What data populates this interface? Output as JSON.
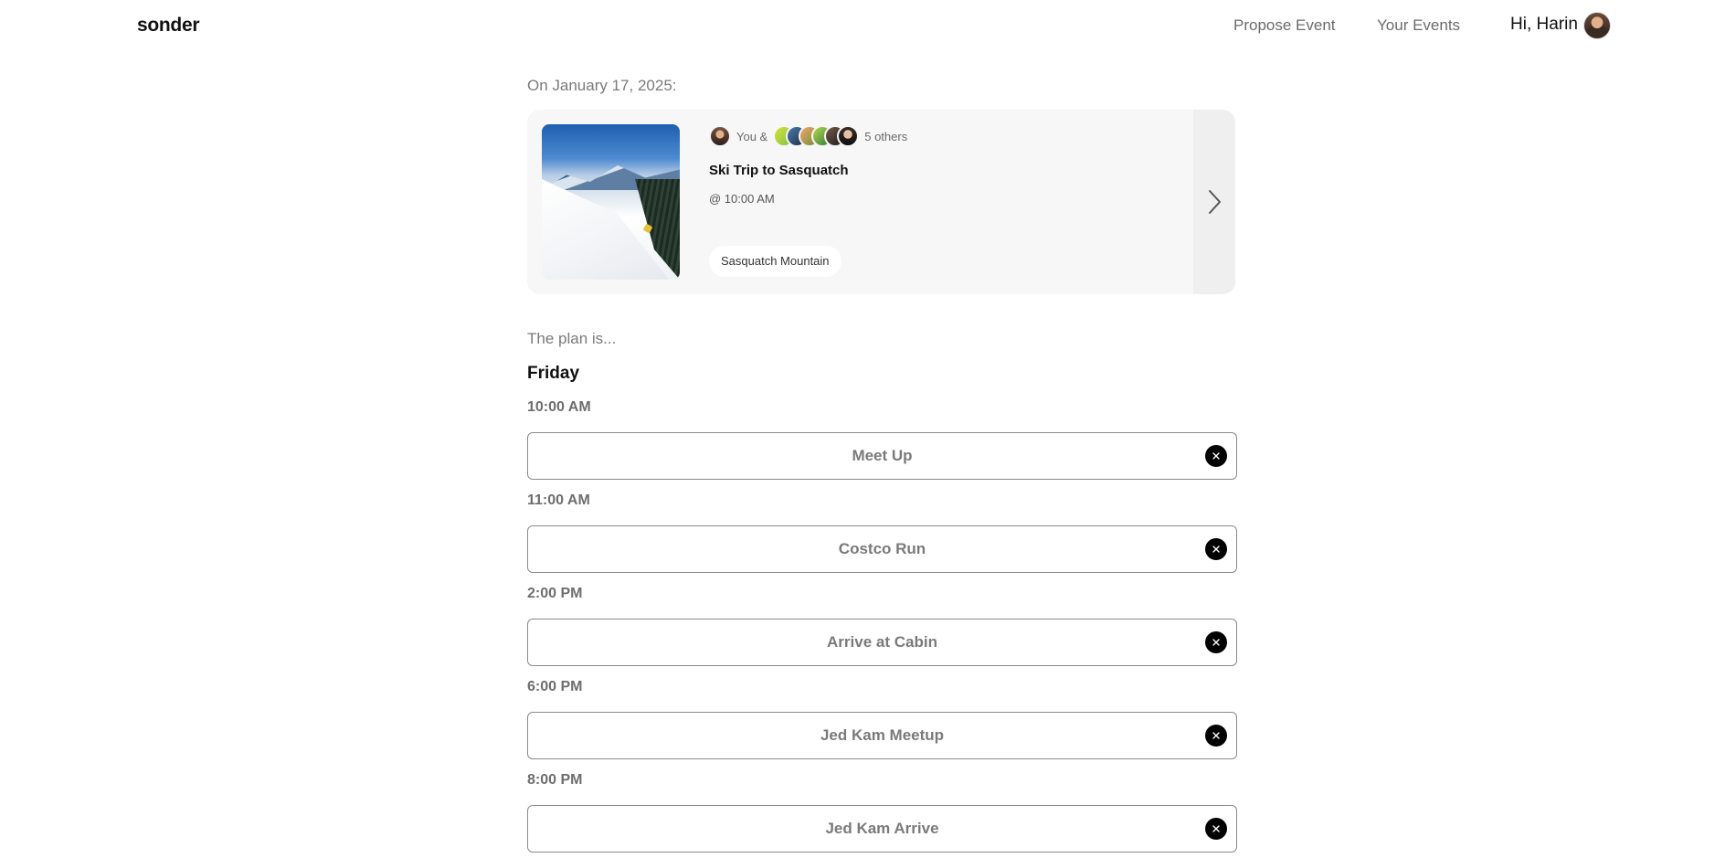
{
  "header": {
    "logo": "sonder",
    "nav": {
      "propose_event": "Propose Event",
      "your_events": "Your Events"
    },
    "greeting": "Hi, Harin"
  },
  "event": {
    "date_label": "On January 17, 2025:",
    "you_label": "You &",
    "others_label": "5 others",
    "title": "Ski Trip to Sasquatch",
    "time": "@ 10:00 AM",
    "location": "Sasquatch Mountain"
  },
  "plan": {
    "intro": "The plan is...",
    "day": "Friday",
    "items": [
      {
        "time": "10:00 AM",
        "label": "Meet Up"
      },
      {
        "time": "11:00 AM",
        "label": "Costco Run"
      },
      {
        "time": "2:00 PM",
        "label": "Arrive at Cabin"
      },
      {
        "time": "6:00 PM",
        "label": "Jed Kam Meetup"
      },
      {
        "time": "8:00 PM",
        "label": "Jed Kam Arrive"
      }
    ]
  },
  "icons": {
    "next": "chevron-right-icon",
    "remove": "close-icon"
  },
  "colors": {
    "card_background": "#f7f7f7",
    "slot_border": "#8a8a8a",
    "muted_text": "#7a7a7a",
    "remove_button": "#000000"
  }
}
